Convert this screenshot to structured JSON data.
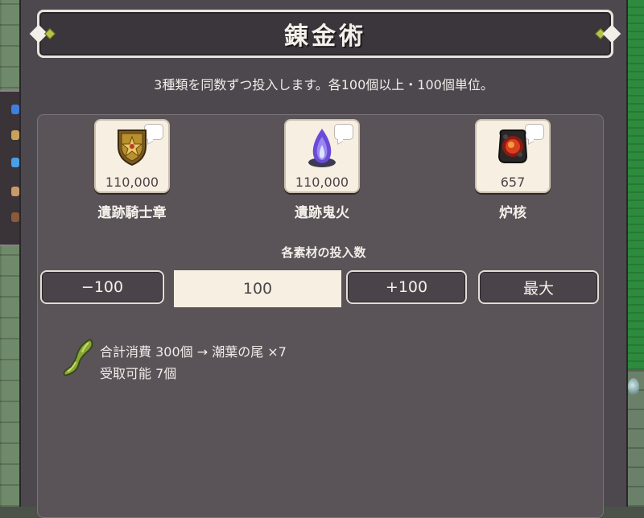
{
  "window": {
    "title": "錬金術",
    "instruction": "3種類を同数ずつ投入します。各100個以上・100個単位。"
  },
  "materials": [
    {
      "name": "遺跡騎士章",
      "count": "110,000",
      "icon": "shield-emblem-icon"
    },
    {
      "name": "遺跡鬼火",
      "count": "110,000",
      "icon": "will-o-wisp-icon"
    },
    {
      "name": "炉核",
      "count": "657",
      "icon": "furnace-core-icon"
    }
  ],
  "quantity": {
    "heading": "各素材の投入数",
    "minus_label": "−100",
    "value": "100",
    "plus_label": "+100",
    "max_label": "最大"
  },
  "result": {
    "icon": "kelp-tail-icon",
    "consume_line": "合計消費 300個 → 潮葉の尾 ×7",
    "receivable_line": "受取可能 7個"
  },
  "colors": {
    "panel_bg": "#4c484e",
    "card_bg": "#f6efe2",
    "title_border": "#e9e3dd",
    "accent_green": "#2e8a3c"
  }
}
